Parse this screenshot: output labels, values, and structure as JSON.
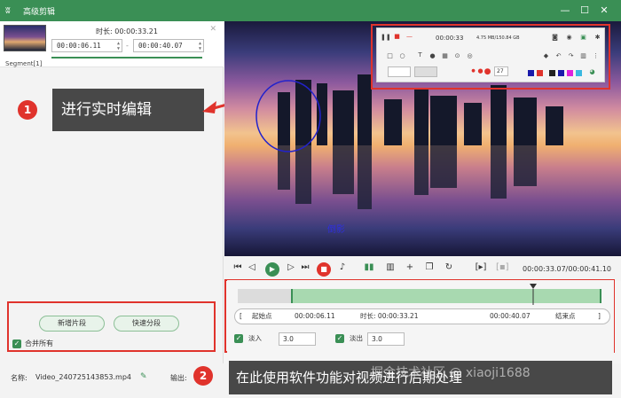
{
  "window": {
    "title": "高级剪辑",
    "logo": "ʬ",
    "minimize": "—",
    "maximize": "☐",
    "close": "✕"
  },
  "clip": {
    "duration_label": "时长:",
    "duration": "00:00:33.21",
    "start": "00:00:06.11",
    "end": "00:00:40.07",
    "separator": "-",
    "segment_label": "Segment[1]"
  },
  "annotations": {
    "step1": {
      "number": "1",
      "text": "进行实时编辑"
    },
    "step2": {
      "number": "2",
      "text": "在此使用软件功能对视频进行后期处理"
    }
  },
  "left_actions": {
    "new_segment": "新增片段",
    "quick_split": "快速分段",
    "merge_all": "合并所有"
  },
  "footer": {
    "name_label": "名称:",
    "filename": "Video_240725143853.mp4",
    "output_label": "输出:",
    "watermark": "掘金技术社区 @ xiaoji1688"
  },
  "video": {
    "overlay_text": "倒影"
  },
  "recorder": {
    "time": "00:00:33",
    "info": "4.75 MB/150.84 GB",
    "size": "27"
  },
  "playback": {
    "current": "00:00:33.07",
    "total": "00:00:41.10",
    "separator": "/"
  },
  "trim": {
    "start_btn": "起始点",
    "start_time": "00:00:06.11",
    "duration_label": "时长:",
    "duration": "00:00:33.21",
    "end_time": "00:00:40.07",
    "end_btn": "结束点",
    "fade_in_label": "淡入",
    "fade_in": "3.0",
    "fade_out_label": "淡出",
    "fade_out": "3.0"
  },
  "colors": {
    "brand": "#3a8f55",
    "annotation_red": "#e0332c"
  }
}
